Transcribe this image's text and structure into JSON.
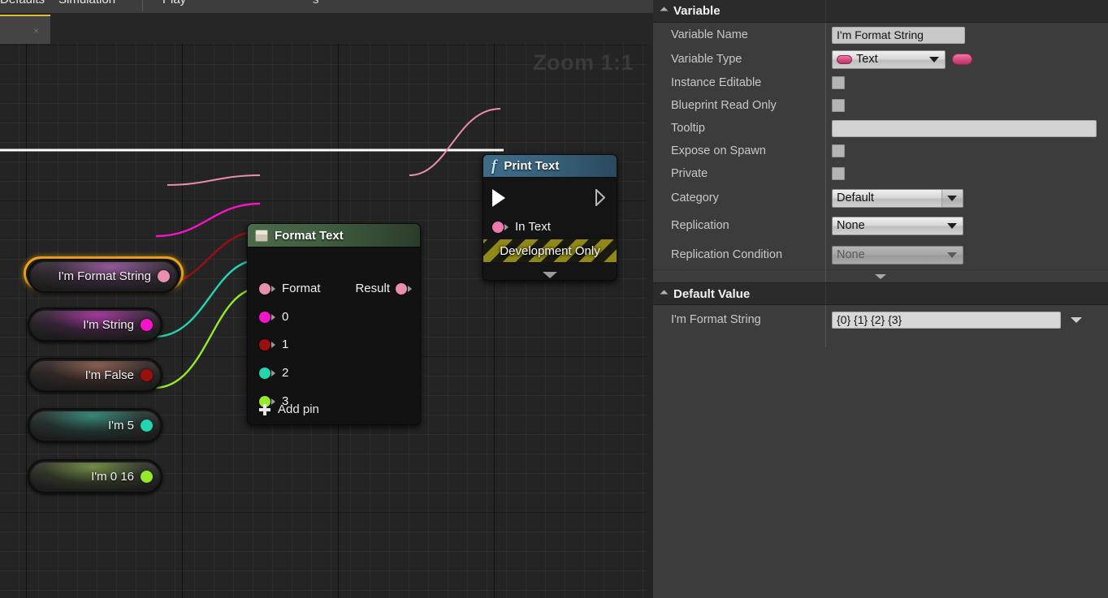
{
  "toolbar": {
    "items": [
      {
        "label": "Defaults"
      },
      {
        "label": "Simulation"
      },
      {
        "label": "Play"
      }
    ],
    "extra_label": "s"
  },
  "tab": {
    "close_icon": "×"
  },
  "graph": {
    "zoom_label": "Zoom 1:1",
    "variable_nodes": [
      {
        "label": "I'm Format String",
        "pin_color": "#e88fb0",
        "glow_color": "#c86ad0",
        "selected": true
      },
      {
        "label": "I'm String",
        "pin_color": "#f514c8",
        "glow_color": "#c83ad8",
        "selected": false
      },
      {
        "label": "I'm False",
        "pin_color": "#9b0f0f",
        "glow_color": "#b06050",
        "selected": false
      },
      {
        "label": "I'm 5",
        "pin_color": "#22d6b0",
        "glow_color": "#2fbfa0",
        "selected": false
      },
      {
        "label": "I'm 0 16",
        "pin_color": "#96e82a",
        "glow_color": "#9bd050",
        "selected": false
      }
    ],
    "format_text_node": {
      "title": "Format Text",
      "inputs": [
        {
          "label": "Format",
          "color": "#e88fb0"
        },
        {
          "label": "0",
          "color": "#f514c8"
        },
        {
          "label": "1",
          "color": "#9b0f0f"
        },
        {
          "label": "2",
          "color": "#22d6b0"
        },
        {
          "label": "3",
          "color": "#96e82a"
        }
      ],
      "output": {
        "label": "Result",
        "color": "#e88fb0"
      },
      "add_pin_label": "Add pin"
    },
    "print_text_node": {
      "title": "Print Text",
      "fx_glyph": "f",
      "input_label": "In Text",
      "input_color": "#ef77ab",
      "dev_only_label": "Development Only"
    }
  },
  "details": {
    "variable_section": {
      "title": "Variable",
      "rows": [
        {
          "label": "Variable Name",
          "type": "text",
          "value": "I'm Format String"
        },
        {
          "label": "Variable Type",
          "type": "combo_pin",
          "value": "Text"
        },
        {
          "label": "Instance Editable",
          "type": "checkbox",
          "value": ""
        },
        {
          "label": "Blueprint Read Only",
          "type": "checkbox",
          "value": ""
        },
        {
          "label": "Tooltip",
          "type": "tooltip",
          "value": ""
        },
        {
          "label": "Expose on Spawn",
          "type": "checkbox",
          "value": ""
        },
        {
          "label": "Private",
          "type": "checkbox",
          "value": ""
        },
        {
          "label": "Category",
          "type": "combo_cat",
          "value": "Default"
        },
        {
          "label": "Replication",
          "type": "combo",
          "value": "None"
        },
        {
          "label": "Replication Condition",
          "type": "combo_disabled",
          "value": "None"
        }
      ]
    },
    "default_value_section": {
      "title": "Default Value",
      "rows": [
        {
          "label": "I'm Format String",
          "type": "text_dropdown",
          "value": "{0} {1} {2} {3}"
        }
      ]
    }
  },
  "colors": {
    "accent_yellow": "#e0c02a",
    "selection_orange": "#f0a515",
    "panel_bg": "#3c3c3c",
    "graph_bg": "#242424"
  }
}
